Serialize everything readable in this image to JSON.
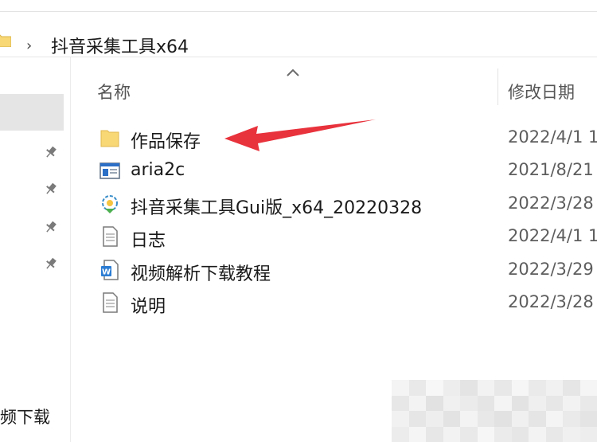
{
  "address_bar": {
    "path": "抖音采集工具x64"
  },
  "nav": {
    "bottom_label": "频下载"
  },
  "header": {
    "name_label": "名称",
    "date_label": "修改日期"
  },
  "files": [
    {
      "name": "作品保存",
      "date": "2022/4/1 1",
      "icon": "folder-icon"
    },
    {
      "name": "aria2c",
      "date": "2021/8/21",
      "icon": "application-icon"
    },
    {
      "name": "抖音采集工具Gui版_x64_20220328",
      "date": "2022/3/28",
      "icon": "program-icon"
    },
    {
      "name": "日志",
      "date": "2022/4/1 1",
      "icon": "text-file-icon"
    },
    {
      "name": "视频解析下载教程",
      "date": "2022/3/29",
      "icon": "word-document-icon"
    },
    {
      "name": "说明",
      "date": "2022/3/28",
      "icon": "text-file-icon"
    }
  ],
  "colors": {
    "folder": "#f8d775",
    "annotation_arrow": "#e8323c",
    "selected_nav": "#e5e5e5",
    "word_blue": "#2b7cd3"
  }
}
